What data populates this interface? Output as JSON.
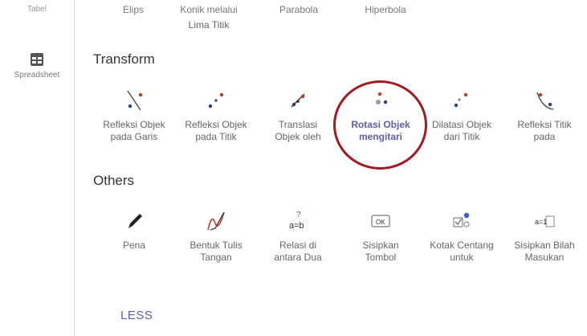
{
  "sidebar": {
    "top_partial_label": "Tabel",
    "spreadsheet_label": "Spreadsheet"
  },
  "top_row": {
    "partial_1": "Elips",
    "partial_2a": "Konik melalui",
    "partial_2b": "Lima Titik",
    "partial_3": "Parabola",
    "partial_4": "Hiperbola"
  },
  "transform": {
    "title": "Transform",
    "tools": [
      {
        "l1": "Refleksi Objek",
        "l2": "pada Garis",
        "icon": "reflect-line-icon"
      },
      {
        "l1": "Refleksi Objek",
        "l2": "pada Titik",
        "icon": "reflect-point-icon"
      },
      {
        "l1": "Translasi",
        "l2": "Objek oleh",
        "icon": "translate-vector-icon"
      },
      {
        "l1": "Rotasi Objek",
        "l2": "mengitari",
        "icon": "rotate-point-icon"
      },
      {
        "l1": "Dilatasi Objek",
        "l2": "dari Titik",
        "icon": "dilate-point-icon"
      },
      {
        "l1": "Refleksi Titik",
        "l2": "pada",
        "icon": "reflect-circle-icon"
      }
    ]
  },
  "others": {
    "title": "Others",
    "tools": [
      {
        "l1": "Pena",
        "l2": "",
        "icon": "pen-icon"
      },
      {
        "l1": "Bentuk Tulis",
        "l2": "Tangan",
        "icon": "freehand-shape-icon"
      },
      {
        "l1": "Relasi di",
        "l2": "antara Dua",
        "icon": "relation-icon",
        "icon_text": "a=b",
        "icon_sup": "?"
      },
      {
        "l1": "Sisipkan",
        "l2": "Tombol",
        "icon": "button-icon",
        "icon_text": "OK"
      },
      {
        "l1": "Kotak Centang",
        "l2": "untuk",
        "icon": "checkbox-icon"
      },
      {
        "l1": "Sisipkan Bilah",
        "l2": "Masukan",
        "icon": "input-box-icon",
        "icon_text": "a=1"
      }
    ]
  },
  "less_label": "LESS",
  "colors": {
    "accent": "#5a5fb0",
    "highlight_circle": "#a31a23",
    "point_red": "#c0392b",
    "point_blue": "#2c3e80"
  }
}
